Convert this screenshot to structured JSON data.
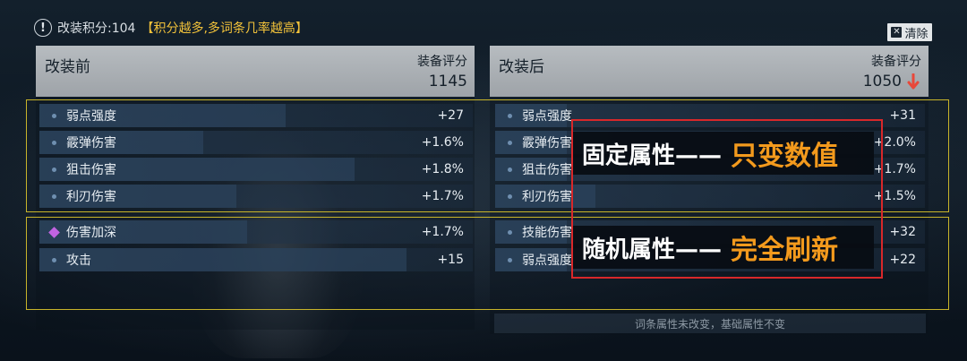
{
  "score": {
    "icon": "exclamation-circle-icon",
    "label": "改装积分:104",
    "tip": "【积分越多,多词条几率越高】"
  },
  "clear_button": {
    "icon": "close-icon",
    "label": "清除"
  },
  "before": {
    "title": "改装前",
    "rating_label": "装备评分",
    "rating_value": "1145",
    "fixed_attrs": [
      {
        "label": "弱点强度",
        "value": "+27"
      },
      {
        "label": "霰弹伤害",
        "value": "+1.6%"
      },
      {
        "label": "狙击伤害",
        "value": "+1.8%"
      },
      {
        "label": "利刃伤害",
        "value": "+1.7%"
      }
    ],
    "random_attrs": [
      {
        "label": "伤害加深",
        "value": "+1.7%",
        "icon": "diamond-icon"
      },
      {
        "label": "攻击",
        "value": "+15",
        "icon": "dot-icon"
      }
    ]
  },
  "after": {
    "title": "改装后",
    "rating_label": "装备评分",
    "rating_value": "1050",
    "rating_trend_icon": "arrow-down-icon",
    "fixed_attrs": [
      {
        "label": "弱点强度",
        "value": "+31"
      },
      {
        "label": "霰弹伤害",
        "value": "+2.0%"
      },
      {
        "label": "狙击伤害",
        "value": "+1.7%"
      },
      {
        "label": "利刃伤害",
        "value": "+1.5%"
      }
    ],
    "random_attrs": [
      {
        "label": "技能伤害",
        "value": "+32"
      },
      {
        "label": "弱点强度",
        "value": "+22"
      }
    ],
    "footer_note": "词条属性未改变，基础属性不变"
  },
  "annotations": {
    "fixed_prefix": "固定属性——",
    "fixed_highlight": "只变数值",
    "random_prefix": "随机属性——",
    "random_highlight": "完全刷新"
  },
  "colors": {
    "tip": "#f2c23a",
    "yellow_frame": "#c8b42a",
    "red_frame": "#d8282a",
    "highlight": "#f39a1d",
    "down_arrow": "#e8483a",
    "diamond": "#c063e0"
  }
}
